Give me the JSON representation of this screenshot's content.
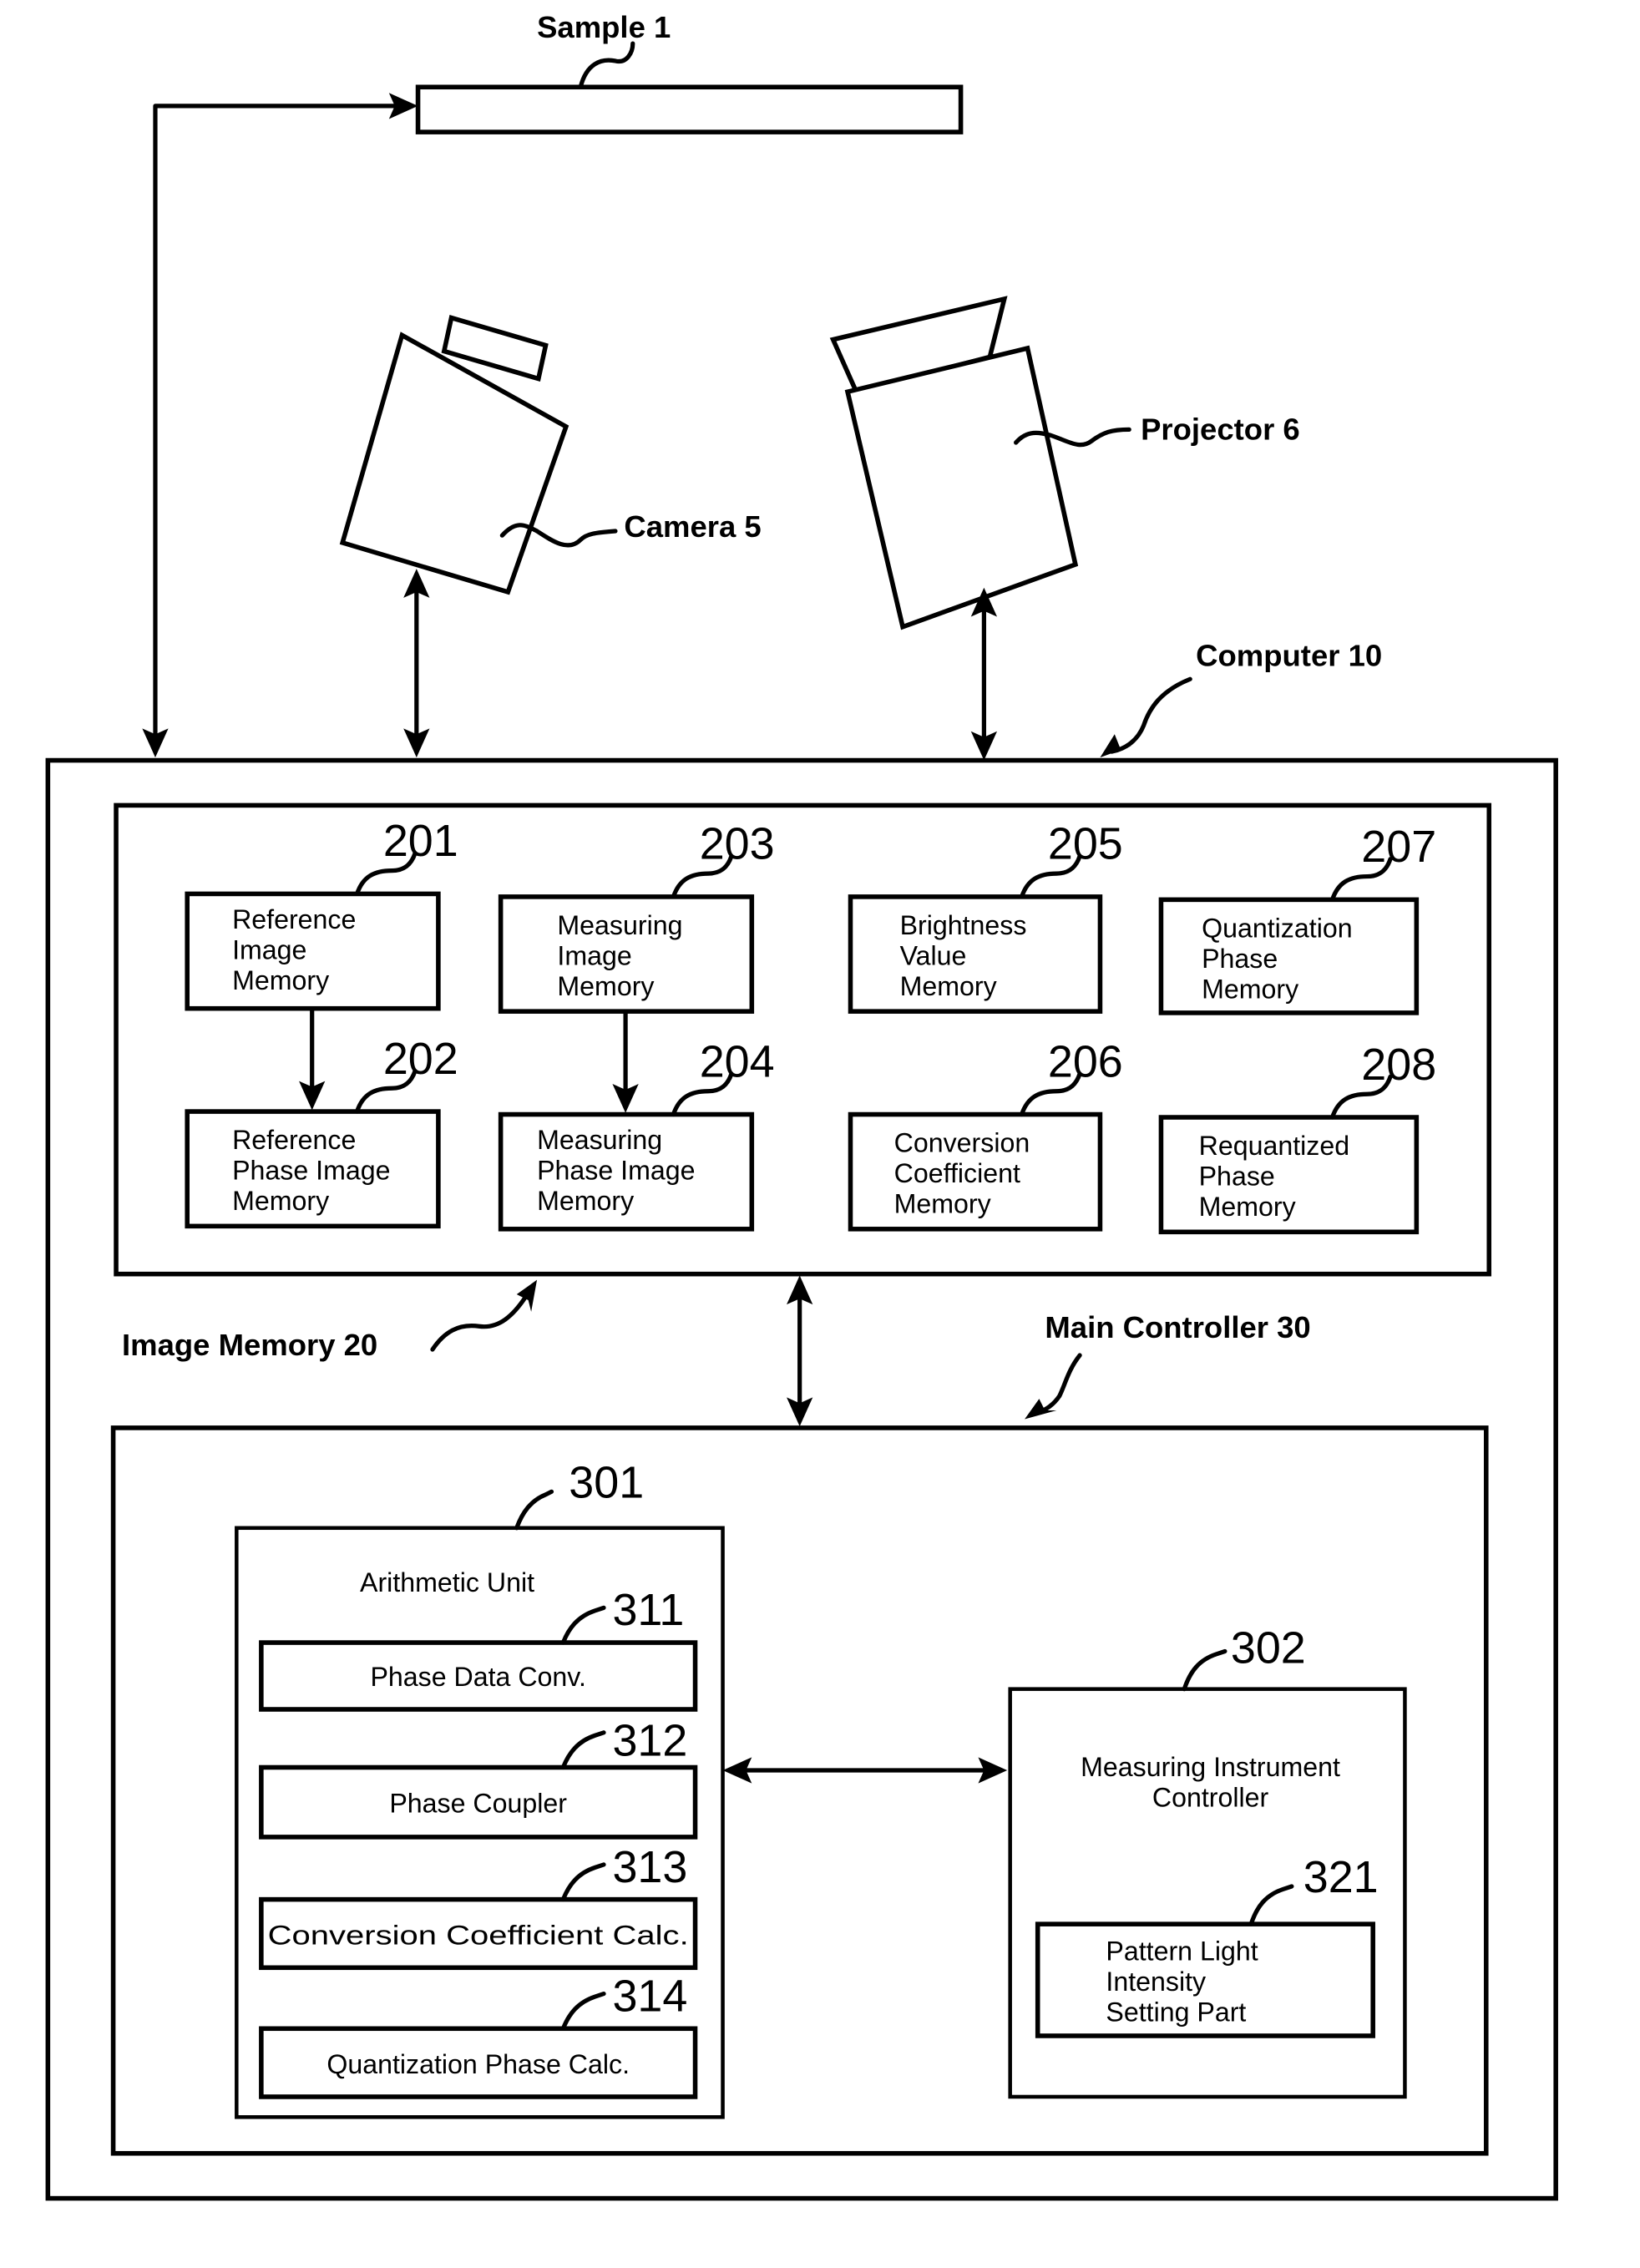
{
  "labels": {
    "sample": "Sample 1",
    "camera": "Camera 5",
    "projector": "Projector 6",
    "computer": "Computer 10",
    "image_memory": "Image Memory 20",
    "main_controller": "Main Controller 30"
  },
  "image_memory_blocks": [
    {
      "ref": "201",
      "lines": [
        "Reference",
        "Image",
        "Memory"
      ]
    },
    {
      "ref": "202",
      "lines": [
        "Reference",
        "Phase Image",
        "Memory"
      ]
    },
    {
      "ref": "203",
      "lines": [
        "Measuring",
        "Image",
        "Memory"
      ]
    },
    {
      "ref": "204",
      "lines": [
        "Measuring",
        "Phase Image",
        "Memory"
      ]
    },
    {
      "ref": "205",
      "lines": [
        "Brightness",
        "Value",
        "Memory"
      ]
    },
    {
      "ref": "206",
      "lines": [
        "Conversion",
        "Coefficient",
        "Memory"
      ]
    },
    {
      "ref": "207",
      "lines": [
        "Quantization",
        "Phase",
        "Memory"
      ]
    },
    {
      "ref": "208",
      "lines": [
        "Requantized",
        "Phase",
        "Memory"
      ]
    }
  ],
  "arithmetic_unit": {
    "ref": "301",
    "title": "Arithmetic Unit",
    "blocks": [
      {
        "ref": "311",
        "label": "Phase Data Conv."
      },
      {
        "ref": "312",
        "label": "Phase Coupler"
      },
      {
        "ref": "313",
        "label": "Conversion Coefficient Calc."
      },
      {
        "ref": "314",
        "label": "Quantization Phase Calc."
      }
    ]
  },
  "instrument_controller": {
    "ref": "302",
    "title_lines": [
      "Measuring Instrument",
      "Controller"
    ],
    "sub_block": {
      "ref": "321",
      "lines": [
        "Pattern Light",
        "Intensity",
        "Setting Part"
      ]
    }
  }
}
